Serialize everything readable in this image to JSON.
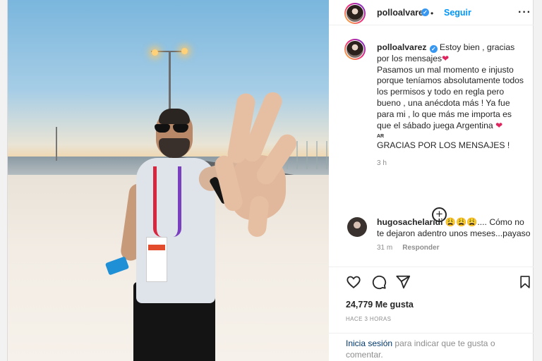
{
  "post": {
    "author": "polloalvarez",
    "follow_label": "Seguir",
    "more_icon": "more-options-icon",
    "separator": "•"
  },
  "caption": {
    "author": "polloalvarez",
    "line1": "Estoy bien , gracias por los mensajes",
    "heart": "❤",
    "body": "Pasamos un mal momento e injusto porque teníamos absolutamente todos los permisos y todo en regla pero bueno , una anécdota más ! Ya fue para mi , lo que más me importa es que el sábado juega Argentina",
    "flag": "AR",
    "thanks": "GRACIAS POR LOS MENSAJES !",
    "time": "3 h"
  },
  "comment": {
    "author": "hugosachelaridi",
    "emojis": "😩😩😩",
    "text": ".... Cómo no te dejaron adentro unos meses...payaso",
    "time": "31 m",
    "reply_label": "Responder"
  },
  "actions": {
    "likes": "24,779 Me gusta",
    "posted": "HACE 3 HORAS"
  },
  "login": {
    "link": "Inicia sesión",
    "text": "para indicar que te gusta o comentar."
  },
  "colors": {
    "accent": "#0095f6",
    "verified": "#3897f0",
    "heart": "#e0245e"
  }
}
